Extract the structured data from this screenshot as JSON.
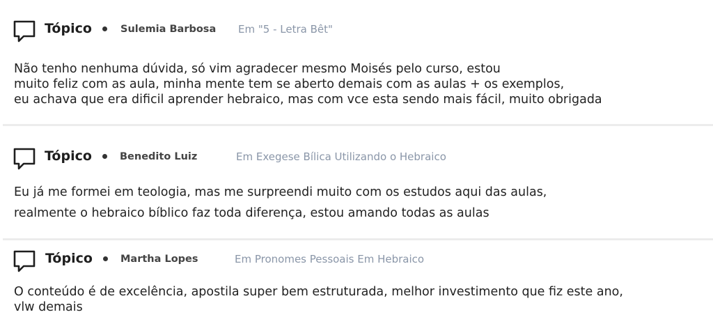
{
  "posts": [
    {
      "type_label": "Tópico",
      "author": "Sulemia Barbosa",
      "context": "Em \"5 - Letra Bêt\"",
      "lines": [
        "Não tenho nenhuma dúvida, só vim agradecer mesmo Moisés pelo curso, estou",
        "muito feliz com as aula, minha mente tem se aberto demais com as aulas + os exemplos,",
        "eu achava que era dificil aprender hebraico, mas com vce esta sendo mais fácil, muito obrigada"
      ]
    },
    {
      "type_label": "Tópico",
      "author": "Benedito Luiz",
      "context": "Em Exegese Bílica Utilizando o Hebraico",
      "lines": [
        "Eu já me formei em teologia, mas me surpreendi muito com os estudos aqui das aulas,",
        "realmente o hebraico bíblico faz toda diferença, estou amando todas as aulas"
      ]
    },
    {
      "type_label": "Tópico",
      "author": "Martha Lopes",
      "context": "Em Pronomes Pessoais Em Hebraico",
      "lines": [
        "O conteúdo é de excelência, apostila super bem estruturada, melhor investimento que fiz este ano,",
        "vlw demais"
      ]
    }
  ],
  "icons": {
    "post_type": "chat-bubble-icon"
  },
  "colors": {
    "author": "#444444",
    "context": "#8a96a8",
    "divider": "#ececec",
    "text": "#222222"
  }
}
